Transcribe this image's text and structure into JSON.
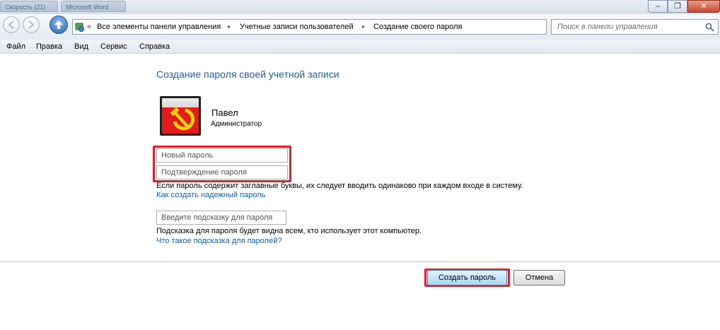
{
  "titlebar": {
    "tabs": [
      "Скорость (21)",
      "Microsoft Word"
    ],
    "minimize_glyph": "–",
    "maximize_glyph": "❐",
    "close_glyph": "✕"
  },
  "nav": {
    "back_icon": "back-arrow-icon",
    "forward_icon": "forward-arrow-icon",
    "up_icon": "up-arrow-icon"
  },
  "address": {
    "overflow_chevron": "«",
    "separator": "▸",
    "crumbs": [
      "Все элементы панели управления",
      "Учетные записи пользователей",
      "Создание своего пароля"
    ]
  },
  "search": {
    "placeholder": "Поиск в панели управления"
  },
  "menu": {
    "items": [
      "Файл",
      "Правка",
      "Вид",
      "Сервис",
      "Справка"
    ]
  },
  "content": {
    "title": "Создание пароля своей учетной записи",
    "user": {
      "name": "Павел",
      "role": "Администратор"
    },
    "new_password_placeholder": "Новый пароль",
    "confirm_password_placeholder": "Подтверждение пароля",
    "case_note": "Если пароль содержит заглавные буквы, их следует вводить одинаково при каждом входе в систему.",
    "strong_password_link": "Как создать надежный пароль",
    "hint_placeholder": "Введите подсказку для пароля",
    "hint_note": "Подсказка для пароля будет видна всем, кто использует этот компьютер.",
    "hint_link": "Что такое подсказка для паролей?"
  },
  "buttons": {
    "create": "Создать пароль",
    "cancel": "Отмена"
  },
  "colors": {
    "title_blue": "#1e5fa8",
    "link_blue": "#0f5fb5",
    "highlight_red": "#e0202a",
    "avatar_red": "#e41b1b"
  }
}
